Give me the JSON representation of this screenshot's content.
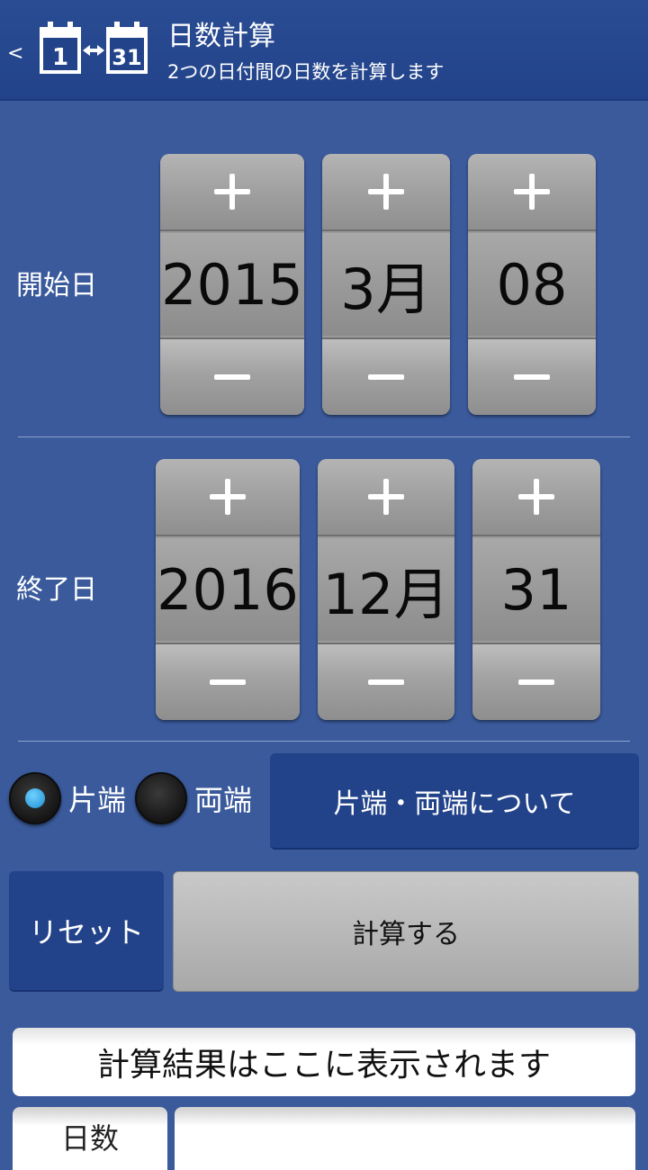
{
  "header": {
    "back_label": "<",
    "logo": {
      "start_day": "1",
      "end_day": "31",
      "icon": "calendar-range-icon"
    },
    "title": "日数計算",
    "subtitle": "2つの日付間の日数を計算します"
  },
  "start_date": {
    "label": "開始日",
    "year": "2015",
    "month": "3月",
    "day": "08"
  },
  "end_date": {
    "label": "終了日",
    "year": "2016",
    "month": "12月",
    "day": "31"
  },
  "options": {
    "one_side_label": "片端",
    "both_sides_label": "両端",
    "selected": "片端",
    "about_label": "片端・両端について"
  },
  "actions": {
    "reset_label": "リセット",
    "calculate_label": "計算する"
  },
  "result": {
    "placeholder": "計算結果はここに表示されます",
    "days_label": "日数",
    "days_value": ""
  },
  "colors": {
    "background": "#3a5a9c",
    "actionbar": "#22438a",
    "button_blue": "#22438a",
    "picker_gray": "#9a9a9a",
    "radio_selected": "#1f8fd0"
  }
}
